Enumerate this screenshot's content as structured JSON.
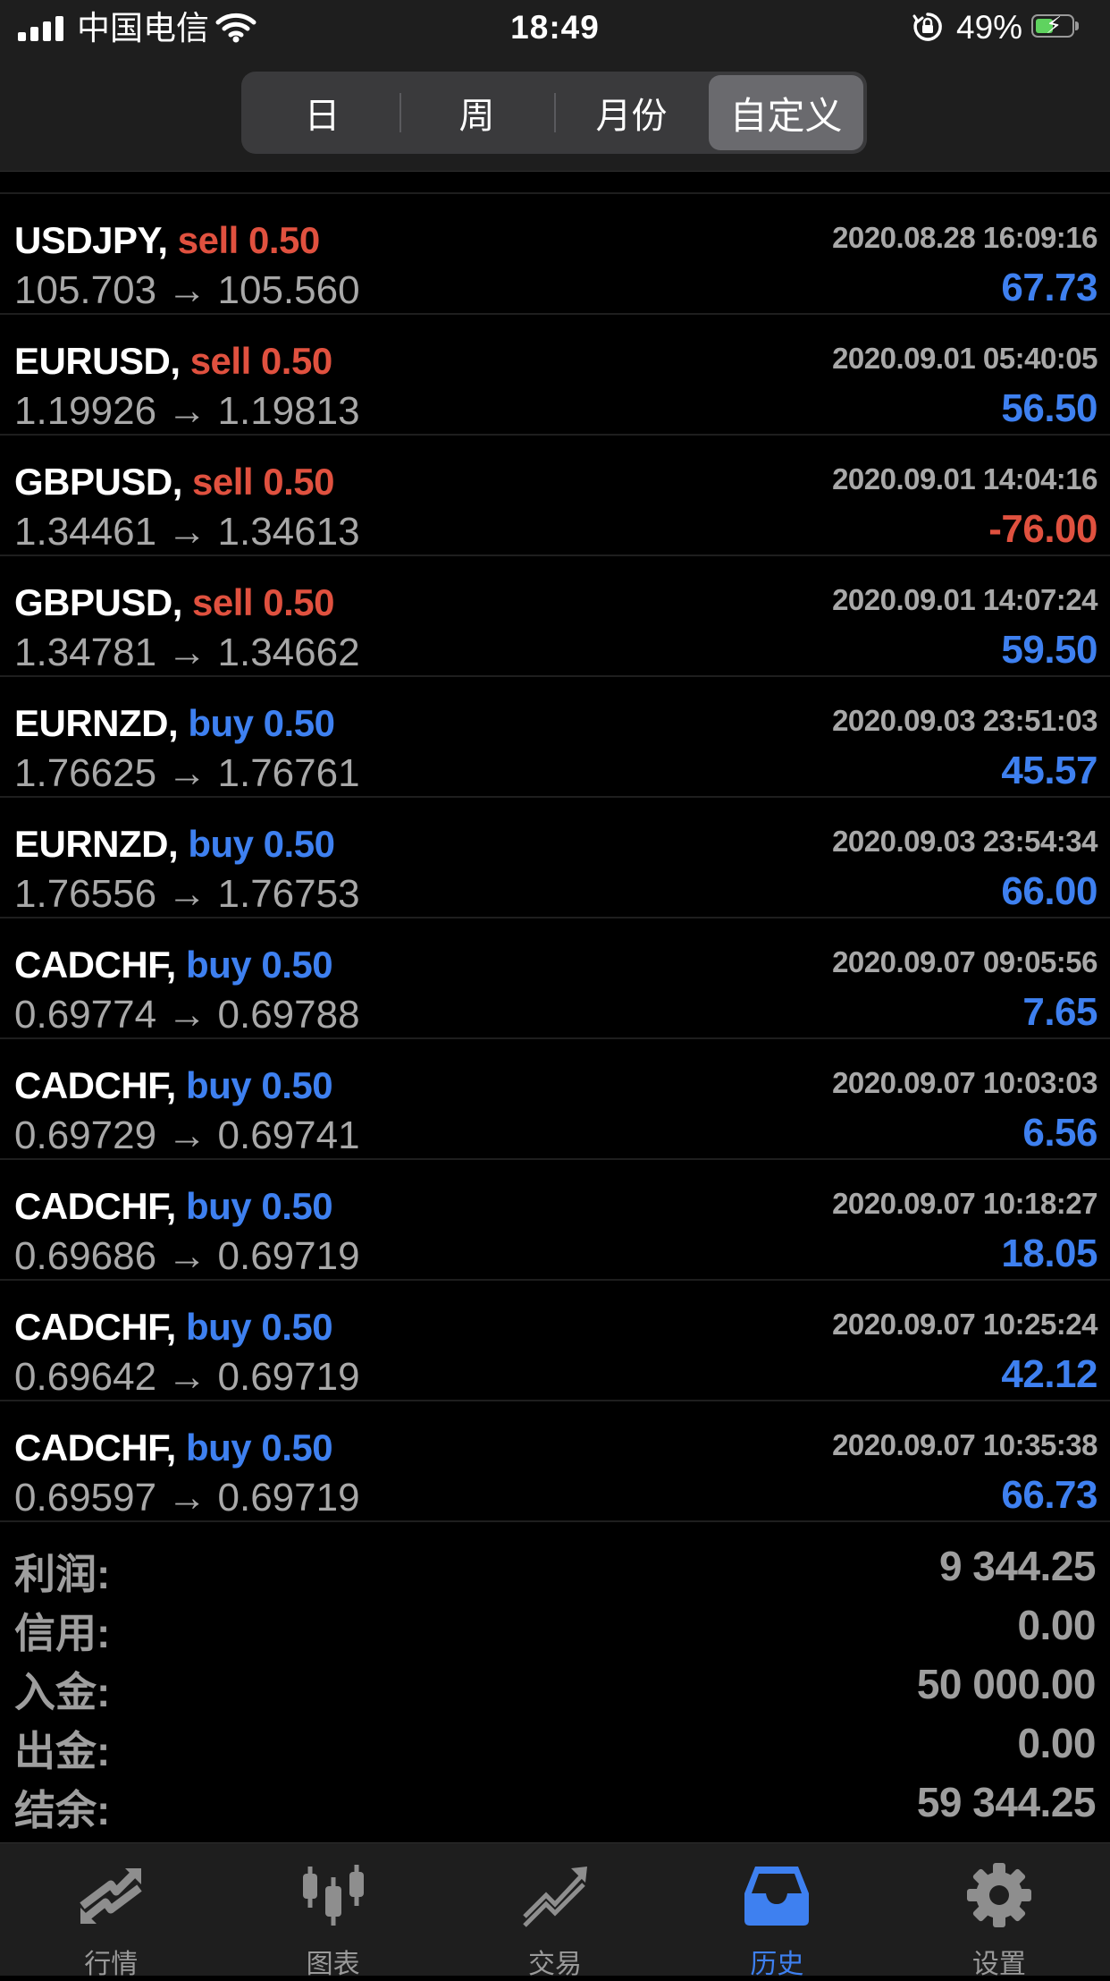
{
  "status_bar": {
    "carrier": "中国电信",
    "time": "18:49",
    "battery_percent": "49%",
    "battery_level": 0.49,
    "battery_charging": true
  },
  "period_tabs": [
    {
      "label": "日",
      "active": false
    },
    {
      "label": "周",
      "active": false
    },
    {
      "label": "月份",
      "active": false
    },
    {
      "label": "自定义",
      "active": true
    }
  ],
  "deals": [
    {
      "symbol": "USDJPY,",
      "side": "sell",
      "volume": "sell 0.50",
      "time": "2020.08.28 16:09:16",
      "prices": "105.703 → 105.560",
      "profit": "67.73",
      "profit_sign": "pos"
    },
    {
      "symbol": "EURUSD,",
      "side": "sell",
      "volume": "sell 0.50",
      "time": "2020.09.01 05:40:05",
      "prices": "1.19926 → 1.19813",
      "profit": "56.50",
      "profit_sign": "pos"
    },
    {
      "symbol": "GBPUSD,",
      "side": "sell",
      "volume": "sell 0.50",
      "time": "2020.09.01 14:04:16",
      "prices": "1.34461 → 1.34613",
      "profit": "-76.00",
      "profit_sign": "neg"
    },
    {
      "symbol": "GBPUSD,",
      "side": "sell",
      "volume": "sell 0.50",
      "time": "2020.09.01 14:07:24",
      "prices": "1.34781 → 1.34662",
      "profit": "59.50",
      "profit_sign": "pos"
    },
    {
      "symbol": "EURNZD,",
      "side": "buy",
      "volume": "buy 0.50",
      "time": "2020.09.03 23:51:03",
      "prices": "1.76625 → 1.76761",
      "profit": "45.57",
      "profit_sign": "pos"
    },
    {
      "symbol": "EURNZD,",
      "side": "buy",
      "volume": "buy 0.50",
      "time": "2020.09.03 23:54:34",
      "prices": "1.76556 → 1.76753",
      "profit": "66.00",
      "profit_sign": "pos"
    },
    {
      "symbol": "CADCHF,",
      "side": "buy",
      "volume": "buy 0.50",
      "time": "2020.09.07 09:05:56",
      "prices": "0.69774 → 0.69788",
      "profit": "7.65",
      "profit_sign": "pos"
    },
    {
      "symbol": "CADCHF,",
      "side": "buy",
      "volume": "buy 0.50",
      "time": "2020.09.07 10:03:03",
      "prices": "0.69729 → 0.69741",
      "profit": "6.56",
      "profit_sign": "pos"
    },
    {
      "symbol": "CADCHF,",
      "side": "buy",
      "volume": "buy 0.50",
      "time": "2020.09.07 10:18:27",
      "prices": "0.69686 → 0.69719",
      "profit": "18.05",
      "profit_sign": "pos"
    },
    {
      "symbol": "CADCHF,",
      "side": "buy",
      "volume": "buy 0.50",
      "time": "2020.09.07 10:25:24",
      "prices": "0.69642 → 0.69719",
      "profit": "42.12",
      "profit_sign": "pos"
    },
    {
      "symbol": "CADCHF,",
      "side": "buy",
      "volume": "buy 0.50",
      "time": "2020.09.07 10:35:38",
      "prices": "0.69597 → 0.69719",
      "profit": "66.73",
      "profit_sign": "pos"
    }
  ],
  "summary": [
    {
      "label": "利润:",
      "value": "9 344.25"
    },
    {
      "label": "信用:",
      "value": "0.00"
    },
    {
      "label": "入金:",
      "value": "50 000.00"
    },
    {
      "label": "出金:",
      "value": "0.00"
    },
    {
      "label": "结余:",
      "value": "59 344.25"
    }
  ],
  "tab_bar": [
    {
      "label": "行情",
      "icon": "quotes-arrows-icon",
      "active": false
    },
    {
      "label": "图表",
      "icon": "candlestick-chart-icon",
      "active": false
    },
    {
      "label": "交易",
      "icon": "trade-trend-icon",
      "active": false
    },
    {
      "label": "历史",
      "icon": "history-inbox-icon",
      "active": true
    },
    {
      "label": "设置",
      "icon": "gear-icon",
      "active": false
    }
  ],
  "colors": {
    "buy": "#3e80f0",
    "sell": "#e0513f",
    "active_tab": "#3e80f0",
    "header_bg": "#1e1e1e"
  }
}
